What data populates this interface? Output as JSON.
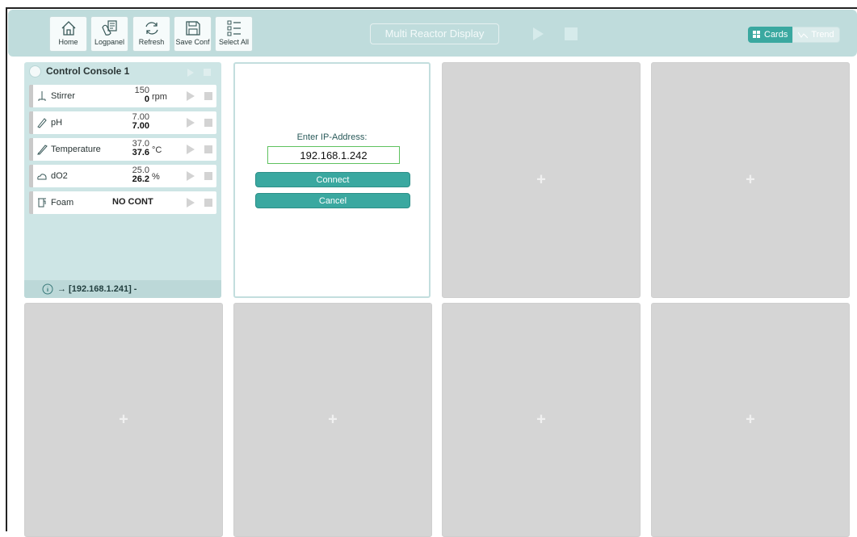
{
  "toolbar": {
    "home_label": "Home",
    "logpanel_label": "Logpanel",
    "refresh_label": "Refresh",
    "saveconf_label": "Save Conf",
    "selectall_label": "Select All",
    "title": "Multi Reactor Display"
  },
  "view_toggle": {
    "cards_label": "Cards",
    "trend_label": "Trend",
    "active": "Cards"
  },
  "console": {
    "title": "Control Console 1",
    "rows": [
      {
        "name": "Stirrer",
        "icon": "stirrer-icon",
        "setpoint": "150",
        "actual": "0",
        "unit": "rpm"
      },
      {
        "name": "pH",
        "icon": "ph-probe-icon",
        "setpoint": "7.00",
        "actual": "7.00",
        "unit": ""
      },
      {
        "name": "Temperature",
        "icon": "thermometer-icon",
        "setpoint": "37.0",
        "actual": "37.6",
        "unit": "°C"
      },
      {
        "name": "dO2",
        "icon": "cloud-icon",
        "setpoint": "25.0",
        "actual": "26.2",
        "unit": "%"
      },
      {
        "name": "Foam",
        "icon": "foam-icon",
        "status": "NO CONT"
      }
    ],
    "footer": "→ [192.168.1.241] -"
  },
  "ip_dialog": {
    "label": "Enter IP-Address:",
    "value": "192.168.1.242",
    "connect_label": "Connect",
    "cancel_label": "Cancel"
  },
  "empty_slot_symbol": "+",
  "colors": {
    "accent": "#3aa8a0",
    "topbar": "#bfdcdc",
    "console_bg": "#cde5e5",
    "empty_card": "#d5d5d5",
    "ip_border": "#5fc25f"
  }
}
